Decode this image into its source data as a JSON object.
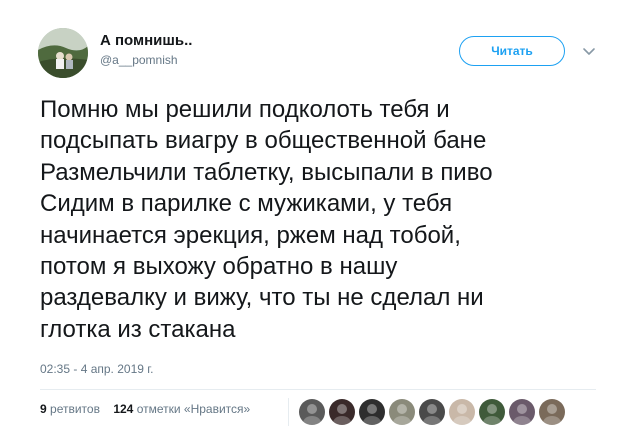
{
  "user": {
    "display_name": "А помнишь..",
    "handle": "@a__pomnish"
  },
  "follow_button": {
    "label": "Читать"
  },
  "tweet": {
    "lines": [
      "Помню мы решили подколоть тебя и",
      "подсыпать виагру в общественной бане",
      "Размельчили таблетку, высыпали в пиво",
      "Сидим в парилке с мужиками, у тебя",
      "начинается эрекция, ржем над тобой,",
      "потом я выхожу обратно в нашу",
      "раздевалку и вижу, что ты не сделал ни",
      "глотка из стакана"
    ],
    "timestamp": "02:35 - 4 апр. 2019 г."
  },
  "stats": {
    "retweets_count": "9",
    "retweets_label": "ретвитов",
    "likes_count": "124",
    "likes_label": "отметки «Нравится»"
  },
  "likers": [
    {
      "name": "liker-1",
      "color": "#5a5a5a"
    },
    {
      "name": "liker-2",
      "color": "#3a2a2a"
    },
    {
      "name": "liker-3",
      "color": "#2e2e2e"
    },
    {
      "name": "liker-4",
      "color": "#8a8a7a"
    },
    {
      "name": "liker-5",
      "color": "#4a4a4a"
    },
    {
      "name": "liker-6",
      "color": "#c9b8a8"
    },
    {
      "name": "liker-7",
      "color": "#3f5a3a"
    },
    {
      "name": "liker-8",
      "color": "#6a5a6a"
    },
    {
      "name": "liker-9",
      "color": "#7a6a5a"
    }
  ],
  "colors": {
    "accent": "#1da1f2",
    "text": "#14171a",
    "muted": "#657786"
  }
}
